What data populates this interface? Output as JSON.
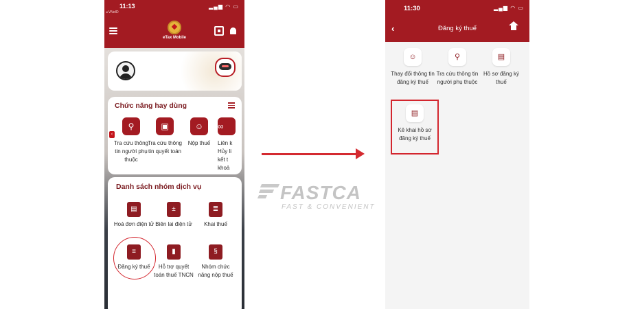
{
  "left_phone": {
    "status": {
      "time": "11:13",
      "carrier": "◂ VNeID"
    },
    "header": {
      "app_name": "eTax Mobile"
    },
    "quick_functions": {
      "title": "Chức năng hay dùng",
      "items": [
        {
          "label": "Tra cứu thông tin người phụ thuộc",
          "icon": "person-search-icon"
        },
        {
          "label": "Tra cứu thông tin quyết toán",
          "icon": "document-search-icon"
        },
        {
          "label": "Nộp thuế",
          "icon": "person-money-icon"
        },
        {
          "label": "Liên k Hủy li kết t khoả",
          "icon": "link-icon"
        }
      ]
    },
    "services": {
      "title": "Danh sách nhóm dịch vụ",
      "items": [
        {
          "label": "Hoá đơn điện tử",
          "icon": "invoice-icon"
        },
        {
          "label": "Biên lai điện tử",
          "icon": "receipt-icon"
        },
        {
          "label": "Khai thuế",
          "icon": "tax-declaration-icon"
        },
        {
          "label": "Đăng ký thuế",
          "icon": "tax-registration-icon"
        },
        {
          "label": "Hỗ trợ quyết toán thuế TNCN",
          "icon": "settlement-support-icon"
        },
        {
          "label": "Nhóm chức năng nộp thuế",
          "icon": "tax-payment-group-icon"
        }
      ]
    }
  },
  "watermark": {
    "title": "FASTCA",
    "subtitle": "FAST & CONVENIENT"
  },
  "right_phone": {
    "status": {
      "time": "11:30"
    },
    "header": {
      "title": "Đăng ký thuế"
    },
    "items": [
      {
        "label": "Thay đổi thông tin đăng ký thuế",
        "icon": "person-edit-icon"
      },
      {
        "label": "Tra cứu thông tin người phụ thuộc",
        "icon": "person-search-icon"
      },
      {
        "label": "Hồ sơ đăng ký thuế",
        "icon": "file-search-icon"
      },
      {
        "label": "Kê khai hồ sơ đăng ký thuế",
        "icon": "file-declare-icon"
      }
    ]
  },
  "colors": {
    "brand": "#a31b22",
    "highlight": "#d3262e",
    "arrow": "#d42a30"
  }
}
